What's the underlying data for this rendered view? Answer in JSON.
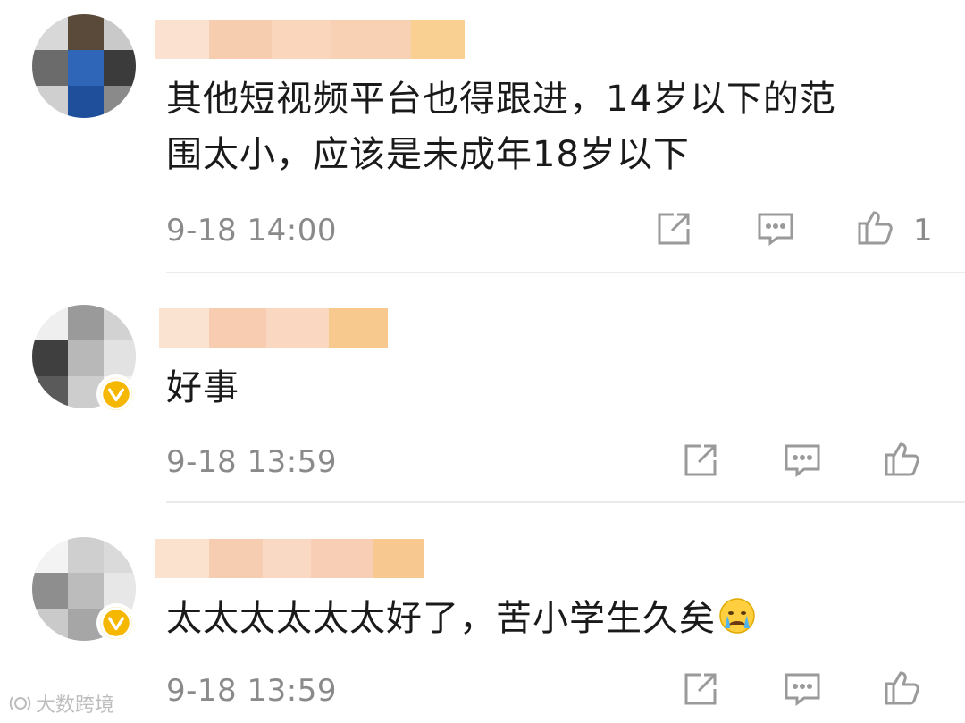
{
  "comments": [
    {
      "text_lines": [
        "其他短视频平台也得跟进，14岁以下的范",
        "围太小，应该是未成年18岁以下"
      ],
      "time": "9-18 14:00",
      "like_count": "1",
      "verified": false
    },
    {
      "text_lines": [
        "好事"
      ],
      "time": "9-18 13:59",
      "like_count": "",
      "verified": true
    },
    {
      "text_lines": [
        "太太太太太太好了，苦小学生久矣"
      ],
      "time": "9-18 13:59",
      "like_count": "",
      "verified": true,
      "emoji": "crying-face-emoji"
    }
  ],
  "icons": {
    "share": "share-icon",
    "reply": "comment-icon",
    "like": "thumbs-up-icon",
    "verified": "verified-badge-icon"
  },
  "watermark": {
    "text": "大数跨境"
  },
  "colors": {
    "text": "#1a1a1a",
    "meta": "#8a8a8a",
    "icon": "#9a9a9a",
    "divider": "#ebebeb",
    "verified": "#f5b700",
    "name_blur": "#f6c9a6"
  }
}
